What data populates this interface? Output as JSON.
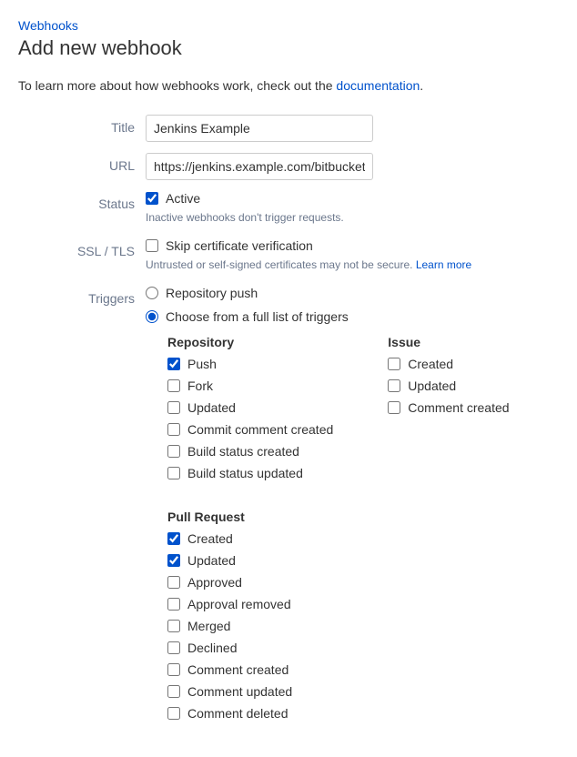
{
  "breadcrumb": "Webhooks",
  "page_title": "Add new webhook",
  "description_prefix": "To learn more about how webhooks work, check out the ",
  "description_link": "documentation",
  "description_suffix": ".",
  "fields": {
    "title": {
      "label": "Title",
      "value": "Jenkins Example"
    },
    "url": {
      "label": "URL",
      "value": "https://jenkins.example.com/bitbucket-"
    },
    "status": {
      "label": "Status",
      "checkbox_label": "Active",
      "hint": "Inactive webhooks don't trigger requests."
    },
    "ssl": {
      "label": "SSL / TLS",
      "checkbox_label": "Skip certificate verification",
      "hint_prefix": "Untrusted or self-signed certificates may not be secure. ",
      "hint_link": "Learn more"
    },
    "triggers": {
      "label": "Triggers",
      "option_repo_push": "Repository push",
      "option_full_list": "Choose from a full list of triggers"
    }
  },
  "trigger_groups": {
    "repository": {
      "title": "Repository",
      "items": [
        {
          "label": "Push",
          "checked": true
        },
        {
          "label": "Fork",
          "checked": false
        },
        {
          "label": "Updated",
          "checked": false
        },
        {
          "label": "Commit comment created",
          "checked": false
        },
        {
          "label": "Build status created",
          "checked": false
        },
        {
          "label": "Build status updated",
          "checked": false
        }
      ]
    },
    "issue": {
      "title": "Issue",
      "items": [
        {
          "label": "Created",
          "checked": false
        },
        {
          "label": "Updated",
          "checked": false
        },
        {
          "label": "Comment created",
          "checked": false
        }
      ]
    },
    "pull_request": {
      "title": "Pull Request",
      "items": [
        {
          "label": "Created",
          "checked": true
        },
        {
          "label": "Updated",
          "checked": true
        },
        {
          "label": "Approved",
          "checked": false
        },
        {
          "label": "Approval removed",
          "checked": false
        },
        {
          "label": "Merged",
          "checked": false
        },
        {
          "label": "Declined",
          "checked": false
        },
        {
          "label": "Comment created",
          "checked": false
        },
        {
          "label": "Comment updated",
          "checked": false
        },
        {
          "label": "Comment deleted",
          "checked": false
        }
      ]
    }
  }
}
